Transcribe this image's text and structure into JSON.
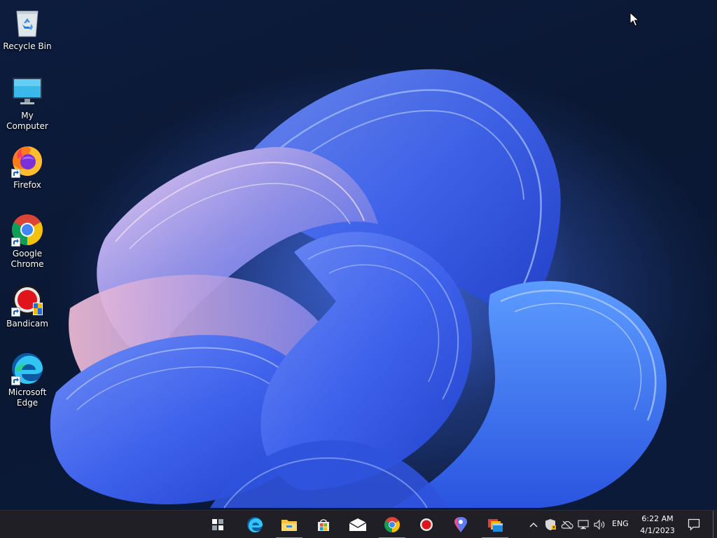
{
  "desktop": {
    "icons": [
      {
        "label": "Recycle Bin"
      },
      {
        "label": "My Computer"
      },
      {
        "label": "Firefox"
      },
      {
        "label": "Google Chrome"
      },
      {
        "label": "Bandicam"
      },
      {
        "label": "Microsoft Edge"
      }
    ]
  },
  "taskbar": {
    "apps": [
      {
        "icon": "start-icon"
      },
      {
        "icon": "edge-icon"
      },
      {
        "icon": "file-explorer-icon",
        "running": true
      },
      {
        "icon": "microsoft-store-icon"
      },
      {
        "icon": "mail-icon"
      },
      {
        "icon": "chrome-icon",
        "running": true
      },
      {
        "icon": "bandicam-icon"
      },
      {
        "icon": "maps-pin-icon"
      },
      {
        "icon": "app-window-icon",
        "running": true
      }
    ],
    "tray": {
      "language": "ENG",
      "time": "6:22 AM",
      "date": "4/1/2023"
    }
  },
  "colors": {
    "taskbar_bg": "#1f1f25",
    "wallpaper_bg": "#0a1630",
    "bloom_blue": "#3e6ef0",
    "bloom_pink": "#c89ad8"
  }
}
